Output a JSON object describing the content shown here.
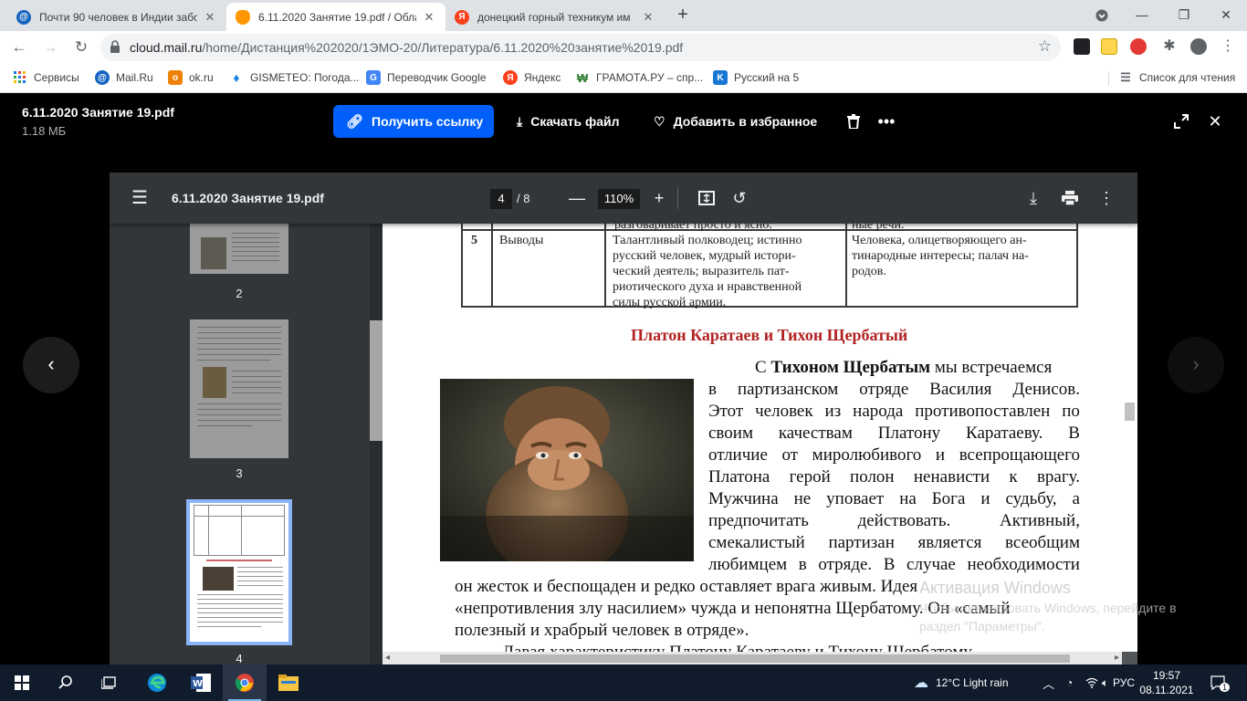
{
  "browser": {
    "tabs": [
      {
        "title": "Почти 90 человек в Индии забо",
        "favicon_color": "#1565c0",
        "icon": "mail-ru-icon"
      },
      {
        "title": "6.11.2020 Занятие 19.pdf / Обла",
        "favicon_color": "#ff9800",
        "icon": "cloud-icon",
        "active": true
      },
      {
        "title": "донецкий горный техникум им",
        "favicon_color": "#f33",
        "icon": "yandex-icon"
      }
    ],
    "address": {
      "host": "cloud.mail.ru",
      "path": "/home/Дистанция%202020/1ЭМО-20/Литература/6.11.2020%20занятие%2019.pdf"
    },
    "bookmarks": [
      {
        "label": "Сервисы",
        "icon": "apps-grid-icon",
        "color": "#5f6368"
      },
      {
        "label": "Mail.Ru",
        "icon": "mail-ru-icon",
        "color": "#1565c0"
      },
      {
        "label": "ok.ru",
        "icon": "ok-icon",
        "color": "#ee8208"
      },
      {
        "label": "GISMETEO: Погода...",
        "icon": "gismeteo-icon",
        "color": "#1e88e5"
      },
      {
        "label": "Переводчик Google",
        "icon": "translate-icon",
        "color": "#4285f4"
      },
      {
        "label": "Яндекс",
        "icon": "yandex-icon",
        "color": "#f33"
      },
      {
        "label": "ГРАМОТА.РУ – спр...",
        "icon": "gramota-icon",
        "color": "#2e7d32"
      },
      {
        "label": "Русский на 5",
        "icon": "russian5-icon",
        "color": "#1976d2"
      }
    ],
    "reading_list": "Список для чтения"
  },
  "viewer": {
    "file_name": "6.11.2020 Занятие 19.pdf",
    "file_size": "1.18 МБ",
    "get_link": "Получить ссылку",
    "download": "Скачать файл",
    "favorite": "Добавить в избранное"
  },
  "pdf": {
    "title": "6.11.2020 Занятие 19.pdf",
    "page_current": "4",
    "page_total": "/  8",
    "zoom": "110%",
    "thumbnails": [
      "2",
      "3",
      "4"
    ],
    "table": {
      "top_left": "разговаривает просто и ясно.",
      "top_right": "ные речи.",
      "row_num": "5",
      "row_label": "Выводы",
      "col2": [
        "Талантливый полководец; истинно",
        "русский человек, мудрый истори-",
        "ческий деятель; выразитель пат-",
        "риотического духа и нравственной",
        "силы русской армии."
      ],
      "col3": [
        "Человека, олицетворяющего ан-",
        "тинародные интересы; палач на-",
        "родов."
      ]
    },
    "heading": "Платон Каратаев и Тихон Щербатый",
    "para1_first": [
      "С ",
      "Тихоном Щербатым",
      " мы встречаемся"
    ],
    "para1_lines": [
      "в партизанском отряде Василия Денисов.",
      "Этот человек из народа противопоставлен по",
      "своим качествам Платону Каратаеву. В",
      "отличие от миролюбивого и всепрощающего",
      "Платона герой полон ненависти к врагу.",
      "Мужчина не уповает на Бога и судьбу, а",
      "предпочитать действовать. Активный,",
      "смекалистый партизан является всеобщим",
      "любимцем в отряде. В случае необходимости"
    ],
    "para1_full": [
      "он жесток и беспощаден и редко оставляет врага живым. Идея",
      "«непротивления злу насилием» чужда и непонятна Щербатому. Он «самый",
      "полезный и храбрый человек в отряде»."
    ],
    "para2": "Давая характеристику Платону Каратаеву и Тихону Щербатому,"
  },
  "activation": {
    "line1": "Активация Windows",
    "line2": "Чтобы активировать Windows, перейдите в",
    "line3": "раздел \"Параметры\"."
  },
  "taskbar": {
    "weather": "12°C  Light rain",
    "lang": "РУС",
    "time": "19:57",
    "date": "08.11.2021",
    "notifications": "1"
  }
}
